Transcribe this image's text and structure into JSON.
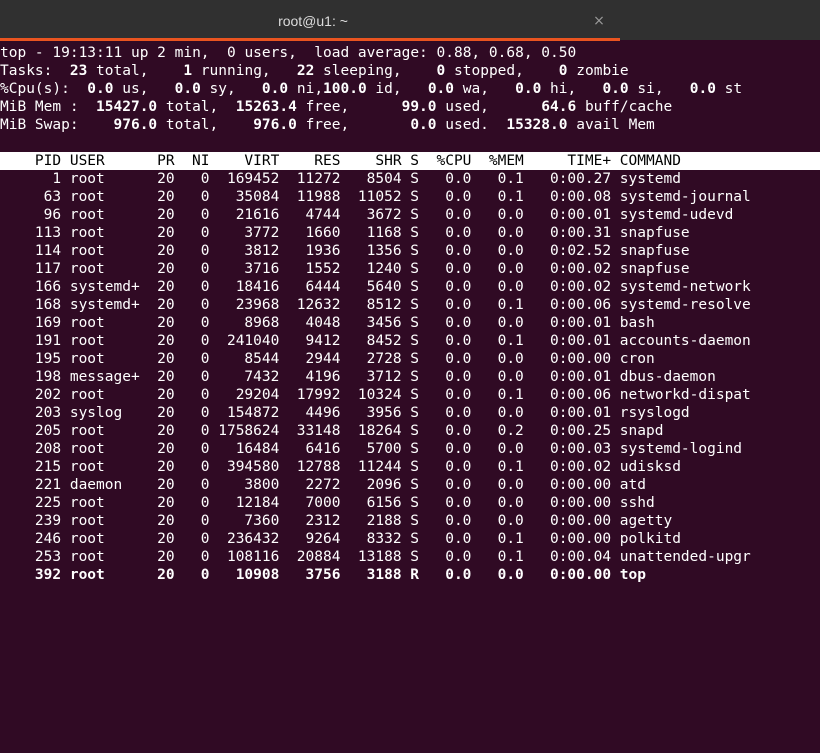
{
  "window": {
    "title": "root@u1: ~",
    "close_symbol": "×"
  },
  "summary": {
    "top_prefix": "top - ",
    "time": "19:13:11",
    "uptime_rest": " up 2 min,  0 users,  load average: ",
    "load_avg": "0.88, 0.68, 0.50",
    "tasks_label": "Tasks: ",
    "tasks_total": " 23",
    "tasks_total_label": " total,   ",
    "tasks_running": " 1",
    "tasks_running_label": " running,  ",
    "tasks_sleeping": " 22",
    "tasks_sleeping_label": " sleeping,   ",
    "tasks_stopped": " 0",
    "tasks_stopped_label": " stopped,   ",
    "tasks_zombie": " 0",
    "tasks_zombie_label": " zombie",
    "cpu_label": "%Cpu(s): ",
    "cpu_us": " 0.0",
    "cpu_us_label": " us,  ",
    "cpu_sy": " 0.0",
    "cpu_sy_label": " sy,  ",
    "cpu_ni": " 0.0",
    "cpu_ni_label": " ni,",
    "cpu_id": "100.0",
    "cpu_id_label": " id,  ",
    "cpu_wa": " 0.0",
    "cpu_wa_label": " wa,  ",
    "cpu_hi": " 0.0",
    "cpu_hi_label": " hi,  ",
    "cpu_si": " 0.0",
    "cpu_si_label": " si,  ",
    "cpu_st": " 0.0",
    "cpu_st_label": " st",
    "mem_label": "MiB Mem : ",
    "mem_total": " 15427.0",
    "mem_total_label": " total, ",
    "mem_free": " 15263.4",
    "mem_free_label": " free, ",
    "mem_used": "     99.0",
    "mem_used_label": " used, ",
    "mem_buff": "     64.6",
    "mem_buff_label": " buff/cache",
    "swap_label": "MiB Swap: ",
    "swap_total": "   976.0",
    "swap_total_label": " total, ",
    "swap_free": "   976.0",
    "swap_free_label": " free, ",
    "swap_used": "      0.0",
    "swap_used_label": " used. ",
    "swap_avail": " 15328.0",
    "swap_avail_label": " avail Mem"
  },
  "process_table": {
    "header": "    PID USER      PR  NI    VIRT    RES    SHR S  %CPU  %MEM     TIME+ COMMAND",
    "rows": [
      "      1 root      20   0  169452  11272   8504 S   0.0   0.1   0:00.27 systemd",
      "     63 root      20   0   35084  11988  11052 S   0.0   0.1   0:00.08 systemd-journal",
      "     96 root      20   0   21616   4744   3672 S   0.0   0.0   0:00.01 systemd-udevd",
      "    113 root      20   0    3772   1660   1168 S   0.0   0.0   0:00.31 snapfuse",
      "    114 root      20   0    3812   1936   1356 S   0.0   0.0   0:02.52 snapfuse",
      "    117 root      20   0    3716   1552   1240 S   0.0   0.0   0:00.02 snapfuse",
      "    166 systemd+  20   0   18416   6444   5640 S   0.0   0.0   0:00.02 systemd-network",
      "    168 systemd+  20   0   23968  12632   8512 S   0.0   0.1   0:00.06 systemd-resolve",
      "    169 root      20   0    8968   4048   3456 S   0.0   0.0   0:00.01 bash",
      "    191 root      20   0  241040   9412   8452 S   0.0   0.1   0:00.01 accounts-daemon",
      "    195 root      20   0    8544   2944   2728 S   0.0   0.0   0:00.00 cron",
      "    198 message+  20   0    7432   4196   3712 S   0.0   0.0   0:00.01 dbus-daemon",
      "    202 root      20   0   29204  17992  10324 S   0.0   0.1   0:00.06 networkd-dispat",
      "    203 syslog    20   0  154872   4496   3956 S   0.0   0.0   0:00.01 rsyslogd",
      "    205 root      20   0 1758624  33148  18264 S   0.0   0.2   0:00.25 snapd",
      "    208 root      20   0   16484   6416   5700 S   0.0   0.0   0:00.03 systemd-logind",
      "    215 root      20   0  394580  12788  11244 S   0.0   0.1   0:00.02 udisksd",
      "    221 daemon    20   0    3800   2272   2096 S   0.0   0.0   0:00.00 atd",
      "    225 root      20   0   12184   7000   6156 S   0.0   0.0   0:00.00 sshd",
      "    239 root      20   0    7360   2312   2188 S   0.0   0.0   0:00.00 agetty",
      "    246 root      20   0  236432   9264   8332 S   0.0   0.1   0:00.00 polkitd",
      "    253 root      20   0  108116  20884  13188 S   0.0   0.1   0:00.04 unattended-upgr"
    ],
    "active_row": "    392 root      20   0   10908   3756   3188 R   0.0   0.0   0:00.00 top"
  }
}
